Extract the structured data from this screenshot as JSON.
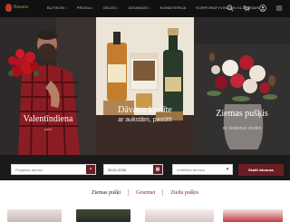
{
  "header": {
    "logo_text": "flowers",
    "nav": [
      {
        "label": "BUTIKOS",
        "chevron": true
      },
      {
        "label": "PROGA",
        "chevron": true
      },
      {
        "label": "GĖLĖS",
        "chevron": true
      },
      {
        "label": "DOVANOS",
        "chevron": true
      },
      {
        "label": "KONDITERIJA",
        "chevron": false
      },
      {
        "label": "KORPORATYVINIAMS KLIENTAMS",
        "chevron": false
      }
    ],
    "icons": [
      "search-icon",
      "cart-icon",
      "user-icon",
      "menu-icon"
    ]
  },
  "hero": {
    "panels": [
      {
        "title": "Valentīndiena",
        "subtitle": "pirkt"
      },
      {
        "title": "Dāvanu kastīte",
        "subtitle": "ar aukstām, pasūtīt"
      },
      {
        "title": "Ziemas pušķis",
        "subtitle": "no šodienas ziedim"
      }
    ]
  },
  "search": {
    "recipient_label": "",
    "recipient_placeholder": "Piegādes adrese",
    "date_value": "30.01.2026",
    "time_placeholder": "Izvēlēties termiņu",
    "button_label": "Skatīt dāvanas"
  },
  "tabs": [
    {
      "label": "Ziemas pušķi",
      "active": true
    },
    {
      "label": "Gourmet",
      "active": false
    },
    {
      "label": "Ziedu pušķis",
      "active": false
    }
  ],
  "colors": {
    "accent": "#6b1d24",
    "tab_text": "#8c1f2a",
    "header_bg": "#111111"
  }
}
